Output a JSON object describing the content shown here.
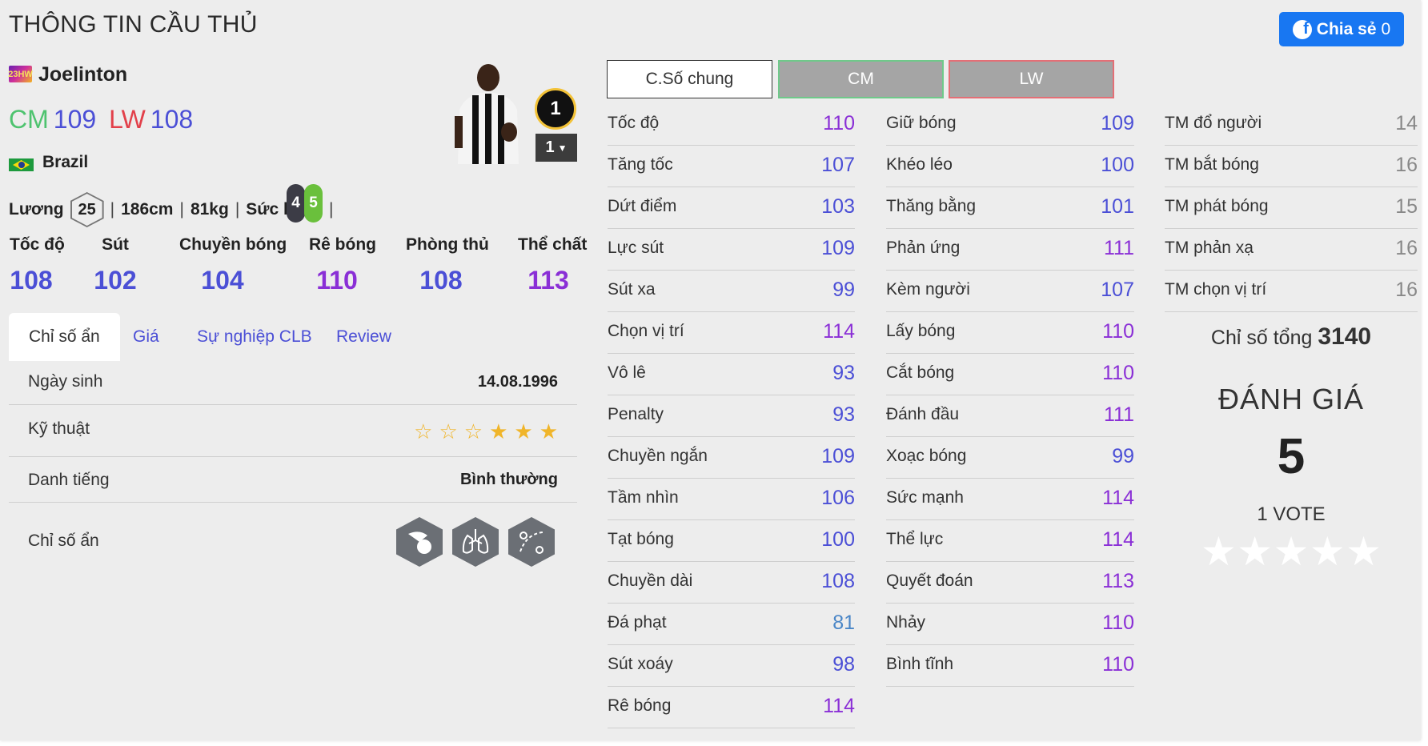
{
  "page": {
    "title": "THÔNG TIN CẦU THỦ"
  },
  "share": {
    "label": "Chia sẻ",
    "count": "0",
    "icon": "facebook-icon"
  },
  "player": {
    "season": "23HW",
    "name": "Joelinton",
    "positions": [
      {
        "pos": "CM",
        "value": "109"
      },
      {
        "pos": "LW",
        "value": "108"
      }
    ],
    "nation": "Brazil",
    "salary_label": "Lương",
    "salary": "25",
    "height": "186cm",
    "weight": "81kg",
    "fitness_label": "Sức khỏe",
    "weak_foot": "4",
    "strong_foot": "5",
    "club_level": "1",
    "rank": "1"
  },
  "main_stats": [
    {
      "label": "Tốc độ",
      "value": "108",
      "color": "#4b4fd6"
    },
    {
      "label": "Sút",
      "value": "102",
      "color": "#4b4fd6"
    },
    {
      "label": "Chuyền bóng",
      "value": "104",
      "color": "#4b4fd6"
    },
    {
      "label": "Rê bóng",
      "value": "110",
      "color": "#8a2fd6"
    },
    {
      "label": "Phòng thủ",
      "value": "108",
      "color": "#4b4fd6"
    },
    {
      "label": "Thể chất",
      "value": "113",
      "color": "#8a2fd6"
    }
  ],
  "tabs": [
    "Chỉ số ẩn",
    "Giá",
    "Sự nghiệp CLB",
    "Review"
  ],
  "info": {
    "birth_label": "Ngày sinh",
    "birth": "14.08.1996",
    "skill_label": "Kỹ thuật",
    "skill_stars": 3,
    "fame_label": "Danh tiếng",
    "fame": "Bình thường",
    "hidden_label": "Chỉ số ẩn",
    "hidden_icons": [
      "powerful-header-icon",
      "lungs-icon",
      "playmaker-icon"
    ]
  },
  "stat_tabs": [
    "C.Số chung",
    "CM",
    "LW"
  ],
  "stats_col1": [
    {
      "k": "Tốc độ",
      "v": "110"
    },
    {
      "k": "Tăng tốc",
      "v": "107"
    },
    {
      "k": "Dứt điểm",
      "v": "103"
    },
    {
      "k": "Lực sút",
      "v": "109"
    },
    {
      "k": "Sút xa",
      "v": "99"
    },
    {
      "k": "Chọn vị trí",
      "v": "114"
    },
    {
      "k": "Vô lê",
      "v": "93"
    },
    {
      "k": "Penalty",
      "v": "93"
    },
    {
      "k": "Chuyền ngắn",
      "v": "109"
    },
    {
      "k": "Tầm nhìn",
      "v": "106"
    },
    {
      "k": "Tạt bóng",
      "v": "100"
    },
    {
      "k": "Chuyền dài",
      "v": "108"
    },
    {
      "k": "Đá phạt",
      "v": "81"
    },
    {
      "k": "Sút xoáy",
      "v": "98"
    },
    {
      "k": "Rê bóng",
      "v": "114"
    }
  ],
  "stats_col2": [
    {
      "k": "Giữ bóng",
      "v": "109"
    },
    {
      "k": "Khéo léo",
      "v": "100"
    },
    {
      "k": "Thăng bằng",
      "v": "101"
    },
    {
      "k": "Phản ứng",
      "v": "111"
    },
    {
      "k": "Kèm người",
      "v": "107"
    },
    {
      "k": "Lấy bóng",
      "v": "110"
    },
    {
      "k": "Cắt bóng",
      "v": "110"
    },
    {
      "k": "Đánh đầu",
      "v": "111"
    },
    {
      "k": "Xoạc bóng",
      "v": "99"
    },
    {
      "k": "Sức mạnh",
      "v": "114"
    },
    {
      "k": "Thể lực",
      "v": "114"
    },
    {
      "k": "Quyết đoán",
      "v": "113"
    },
    {
      "k": "Nhảy",
      "v": "110"
    },
    {
      "k": "Bình tĩnh",
      "v": "110"
    }
  ],
  "stats_col3": [
    {
      "k": "TM đổ người",
      "v": "14"
    },
    {
      "k": "TM bắt bóng",
      "v": "16"
    },
    {
      "k": "TM phát bóng",
      "v": "15"
    },
    {
      "k": "TM phản xạ",
      "v": "16"
    },
    {
      "k": "TM chọn vị trí",
      "v": "16"
    }
  ],
  "summary": {
    "total_label": "Chỉ số tổng",
    "total": "3140",
    "rating_title": "ĐÁNH GIÁ",
    "rating": "5",
    "votes": "1 VOTE"
  }
}
